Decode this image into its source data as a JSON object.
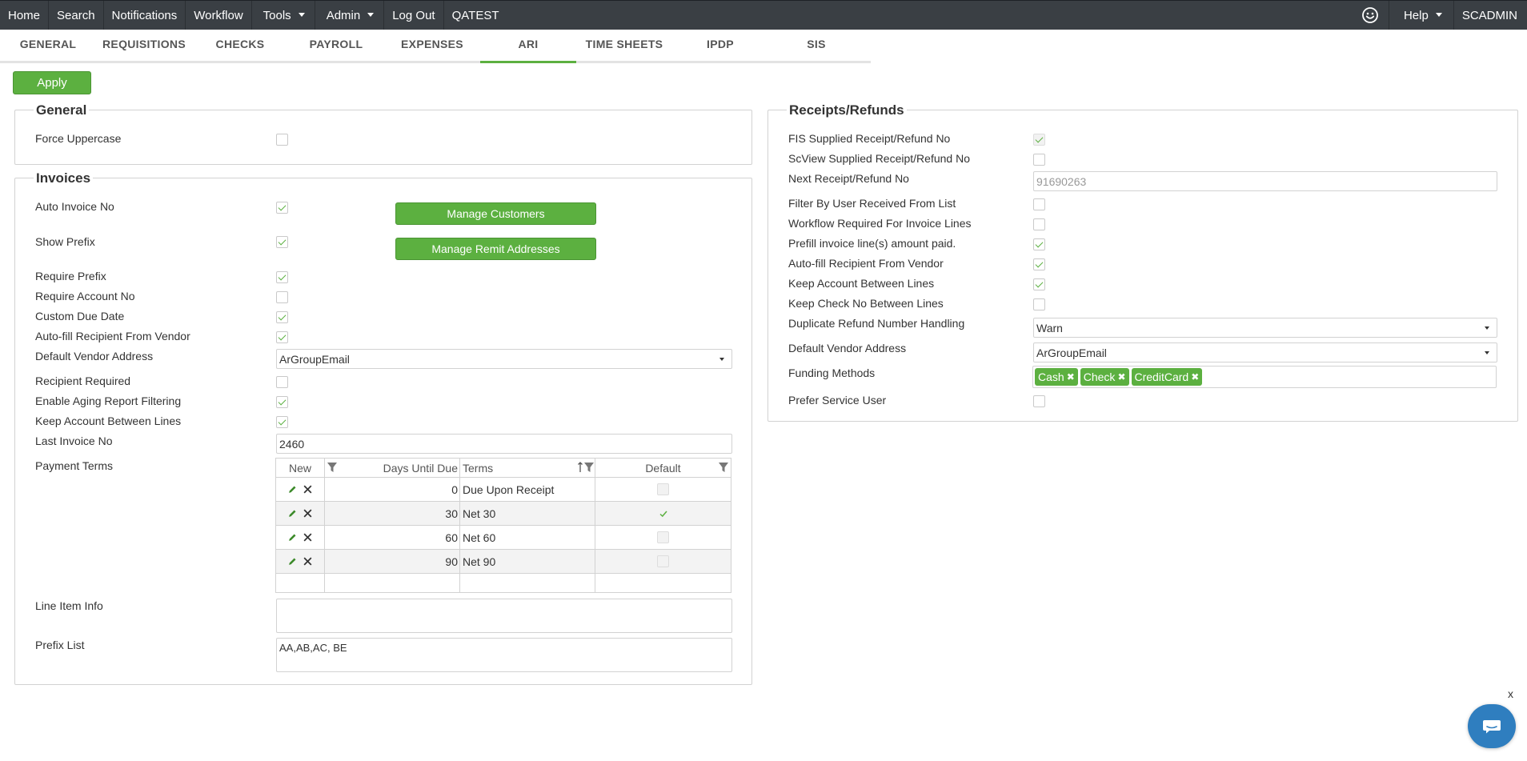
{
  "topnav": {
    "items": [
      "Home",
      "Search",
      "Notifications",
      "Workflow"
    ],
    "tools": "Tools",
    "admin": "Admin",
    "logout": "Log Out",
    "env": "QATEST",
    "help": "Help",
    "user": "SCADMIN"
  },
  "tabs": [
    "GENERAL",
    "REQUISITIONS",
    "CHECKS",
    "PAYROLL",
    "EXPENSES",
    "ARI",
    "TIME SHEETS",
    "IPDP",
    "SIS"
  ],
  "active_tab": "ARI",
  "apply_label": "Apply",
  "general": {
    "title": "General",
    "force_uppercase": {
      "label": "Force Uppercase",
      "checked": false
    }
  },
  "invoices": {
    "title": "Invoices",
    "manage_customers": "Manage Customers",
    "manage_remit": "Manage Remit Addresses",
    "fields": {
      "auto_invoice_no": {
        "label": "Auto Invoice No",
        "checked": true
      },
      "show_prefix": {
        "label": "Show Prefix",
        "checked": true
      },
      "require_prefix": {
        "label": "Require Prefix",
        "checked": true
      },
      "require_account_no": {
        "label": "Require Account No",
        "checked": false
      },
      "custom_due_date": {
        "label": "Custom Due Date",
        "checked": true
      },
      "auto_fill_recipient": {
        "label": "Auto-fill Recipient From Vendor",
        "checked": true
      },
      "recipient_required": {
        "label": "Recipient Required",
        "checked": false
      },
      "enable_aging": {
        "label": "Enable Aging Report Filtering",
        "checked": true
      },
      "keep_account": {
        "label": "Keep Account Between Lines",
        "checked": true
      }
    },
    "default_vendor_address": {
      "label": "Default Vendor Address",
      "value": "ArGroupEmail"
    },
    "last_invoice_no": {
      "label": "Last Invoice No",
      "value": "2460"
    },
    "payment_terms": {
      "label": "Payment Terms",
      "new_label": "New",
      "columns": [
        "Days Until Due",
        "Terms",
        "Default"
      ],
      "rows": [
        {
          "days": "0",
          "terms": "Due Upon Receipt",
          "default": false
        },
        {
          "days": "30",
          "terms": "Net 30",
          "default": true
        },
        {
          "days": "60",
          "terms": "Net 60",
          "default": false
        },
        {
          "days": "90",
          "terms": "Net 90",
          "default": false
        }
      ]
    },
    "line_item_info": {
      "label": "Line Item Info",
      "value": ""
    },
    "prefix_list": {
      "label": "Prefix List",
      "value": "AA,AB,AC, BE"
    }
  },
  "receipts": {
    "title": "Receipts/Refunds",
    "fis_supplied": {
      "label": "FIS Supplied Receipt/Refund No",
      "checked": true
    },
    "scview_supplied": {
      "label": "ScView Supplied Receipt/Refund No",
      "checked": false
    },
    "next_no": {
      "label": "Next Receipt/Refund No",
      "value": "91690263"
    },
    "filter_by_user": {
      "label": "Filter By User Received From List",
      "checked": false
    },
    "workflow_required": {
      "label": "Workflow Required For Invoice Lines",
      "checked": false
    },
    "prefill_amount": {
      "label": "Prefill invoice line(s) amount paid.",
      "checked": true
    },
    "auto_fill_recipient": {
      "label": "Auto-fill Recipient From Vendor",
      "checked": true
    },
    "keep_account": {
      "label": "Keep Account Between Lines",
      "checked": true
    },
    "keep_check_no": {
      "label": "Keep Check No Between Lines",
      "checked": false
    },
    "duplicate_refund": {
      "label": "Duplicate Refund Number Handling",
      "value": "Warn"
    },
    "default_vendor_address": {
      "label": "Default Vendor Address",
      "value": "ArGroupEmail"
    },
    "funding_methods": {
      "label": "Funding Methods",
      "tags": [
        "Cash",
        "Check",
        "CreditCard"
      ]
    },
    "prefer_service_user": {
      "label": "Prefer Service User",
      "checked": false
    }
  },
  "chat": {
    "close": "x"
  },
  "colors": {
    "accent": "#5cb040",
    "nav_bg": "#3a3f44",
    "chat": "#2f7ebf"
  },
  "icons": [
    "smiley-icon",
    "edit-icon",
    "delete-icon",
    "filter-icon",
    "sort-icon",
    "chat-icon",
    "chevron-down-icon"
  ]
}
